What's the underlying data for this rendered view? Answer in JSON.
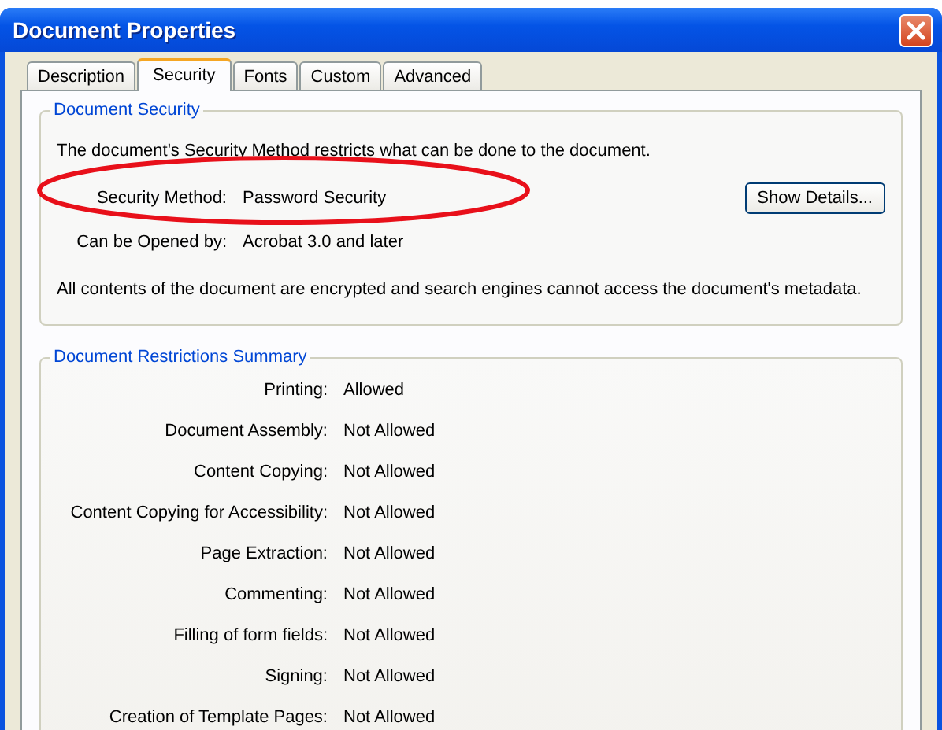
{
  "window": {
    "title": "Document Properties"
  },
  "tabs": [
    {
      "label": "Description",
      "selected": false
    },
    {
      "label": "Security",
      "selected": true
    },
    {
      "label": "Fonts",
      "selected": false
    },
    {
      "label": "Custom",
      "selected": false
    },
    {
      "label": "Advanced",
      "selected": false
    }
  ],
  "document_security": {
    "title": "Document Security",
    "intro": "The document's Security Method restricts what can be done to the document.",
    "fields": [
      {
        "label": "Security Method:",
        "value": "Password Security",
        "button": "Show Details..."
      },
      {
        "label": "Can be Opened by:",
        "value": "Acrobat 3.0 and later"
      }
    ],
    "note": "All contents of the document are encrypted and search engines cannot access the document's metadata."
  },
  "restrictions": {
    "title": "Document Restrictions Summary",
    "rows": [
      {
        "label": "Printing:",
        "value": "Allowed"
      },
      {
        "label": "Document Assembly:",
        "value": "Not Allowed"
      },
      {
        "label": "Content Copying:",
        "value": "Not Allowed"
      },
      {
        "label": "Content Copying for Accessibility:",
        "value": "Not Allowed"
      },
      {
        "label": "Page Extraction:",
        "value": "Not Allowed"
      },
      {
        "label": "Commenting:",
        "value": "Not Allowed"
      },
      {
        "label": "Filling of form fields:",
        "value": "Not Allowed"
      },
      {
        "label": "Signing:",
        "value": "Not Allowed"
      },
      {
        "label": "Creation of Template Pages:",
        "value": "Not Allowed"
      }
    ]
  }
}
